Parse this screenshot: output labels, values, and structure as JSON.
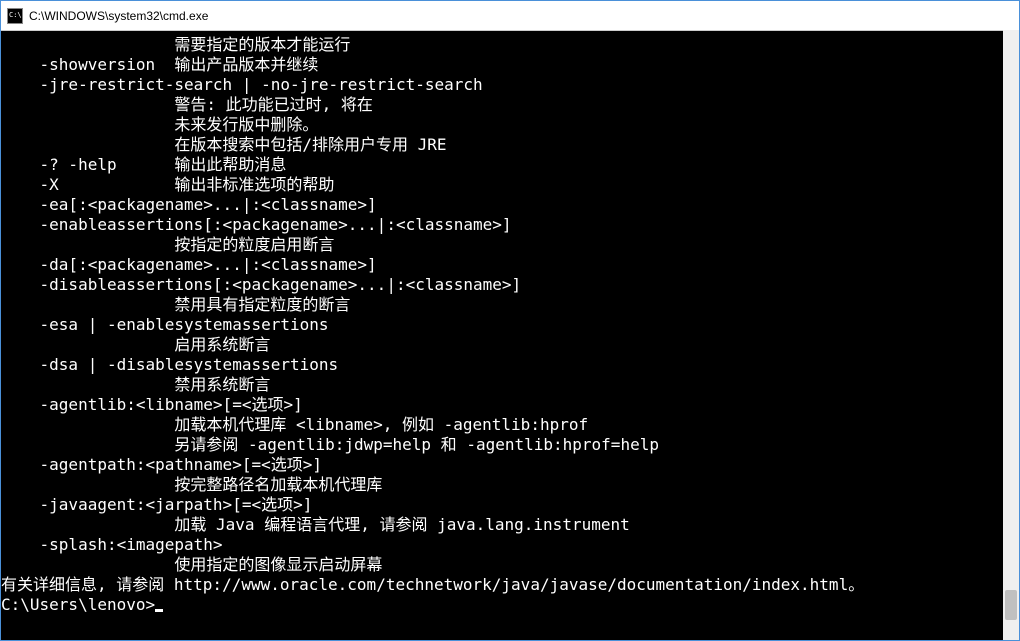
{
  "window": {
    "title": "C:\\WINDOWS\\system32\\cmd.exe"
  },
  "terminal": {
    "lines": [
      "                  需要指定的版本才能运行",
      "    -showversion  输出产品版本并继续",
      "    -jre-restrict-search | -no-jre-restrict-search",
      "                  警告: 此功能已过时, 将在",
      "                  未来发行版中删除。",
      "                  在版本搜索中包括/排除用户专用 JRE",
      "    -? -help      输出此帮助消息",
      "    -X            输出非标准选项的帮助",
      "    -ea[:<packagename>...|:<classname>]",
      "    -enableassertions[:<packagename>...|:<classname>]",
      "                  按指定的粒度启用断言",
      "    -da[:<packagename>...|:<classname>]",
      "    -disableassertions[:<packagename>...|:<classname>]",
      "                  禁用具有指定粒度的断言",
      "    -esa | -enablesystemassertions",
      "                  启用系统断言",
      "    -dsa | -disablesystemassertions",
      "                  禁用系统断言",
      "    -agentlib:<libname>[=<选项>]",
      "                  加载本机代理库 <libname>, 例如 -agentlib:hprof",
      "                  另请参阅 -agentlib:jdwp=help 和 -agentlib:hprof=help",
      "    -agentpath:<pathname>[=<选项>]",
      "                  按完整路径名加载本机代理库",
      "    -javaagent:<jarpath>[=<选项>]",
      "                  加载 Java 编程语言代理, 请参阅 java.lang.instrument",
      "    -splash:<imagepath>",
      "                  使用指定的图像显示启动屏幕",
      "有关详细信息, 请参阅 http://www.oracle.com/technetwork/java/javase/documentation/index.html。",
      ""
    ],
    "prompt": "C:\\Users\\lenovo>"
  }
}
